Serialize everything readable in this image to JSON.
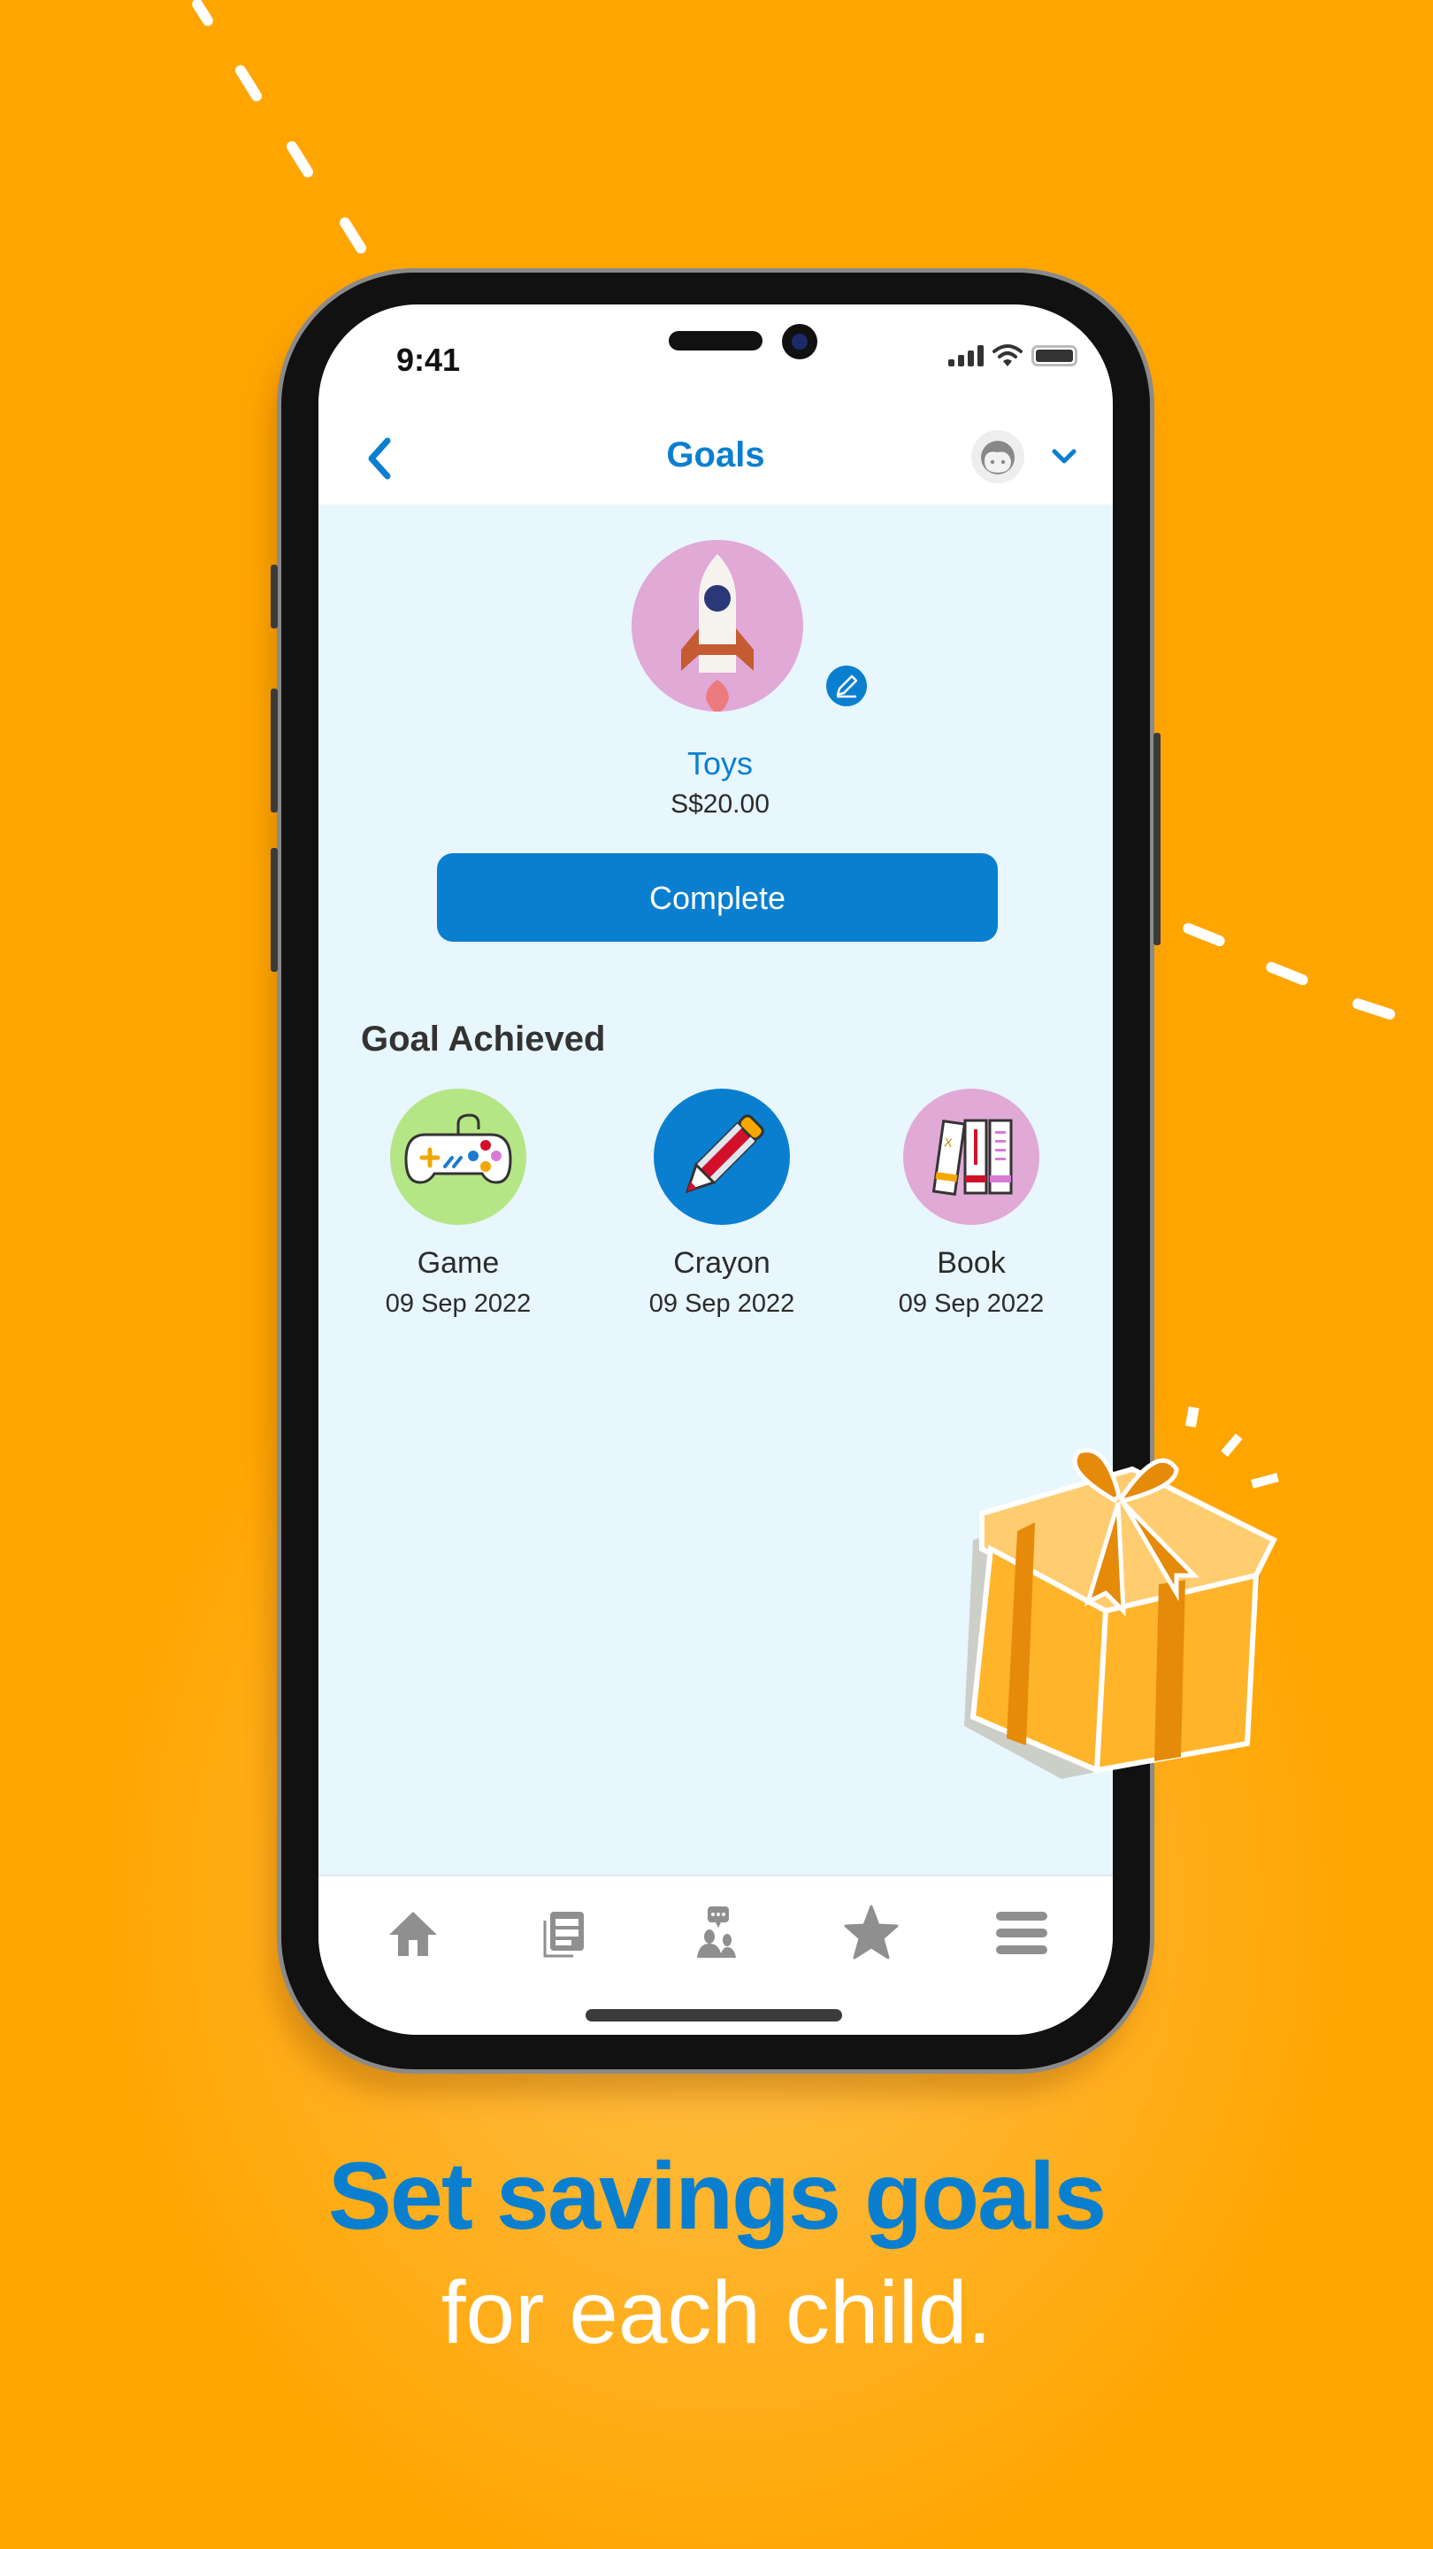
{
  "status_bar": {
    "time": "9:41"
  },
  "header": {
    "title": "Goals"
  },
  "current_goal": {
    "name": "Toys",
    "amount": "S$20.00",
    "icon": "rocket-icon",
    "complete_label": "Complete"
  },
  "achieved": {
    "title": "Goal Achieved",
    "items": [
      {
        "name": "Game",
        "date": "09 Sep 2022",
        "icon": "game-controller-icon",
        "color": "#b5e685"
      },
      {
        "name": "Crayon",
        "date": "09 Sep 2022",
        "icon": "crayon-icon",
        "color": "#0a7fd0"
      },
      {
        "name": "Book",
        "date": "09 Sep 2022",
        "icon": "books-icon",
        "color": "#e0a9d6"
      }
    ]
  },
  "tabbar": {
    "items": [
      {
        "name": "home",
        "icon": "home-icon"
      },
      {
        "name": "news",
        "icon": "news-icon"
      },
      {
        "name": "community",
        "icon": "community-chat-icon"
      },
      {
        "name": "rewards",
        "icon": "star-icon"
      },
      {
        "name": "menu",
        "icon": "menu-icon"
      }
    ]
  },
  "marketing": {
    "headline": "Set savings goals",
    "subline": "for each child."
  },
  "colors": {
    "background": "#ffa500",
    "accent": "#0a7fd0",
    "content_bg": "#e8f6fe"
  }
}
